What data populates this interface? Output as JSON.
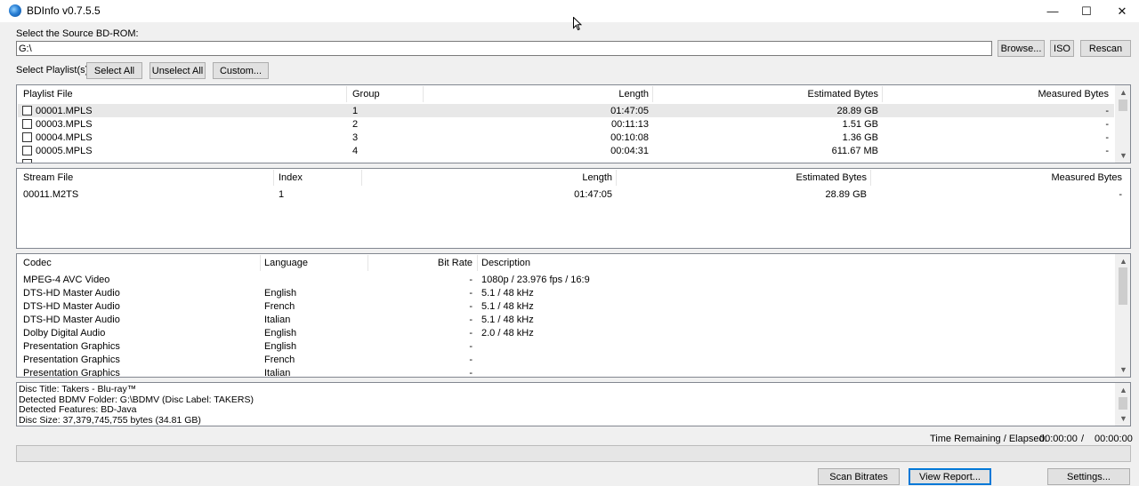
{
  "window": {
    "title": "BDInfo v0.7.5.5",
    "controls": {
      "minimize": "—",
      "maximize": "☐",
      "close": "✕"
    }
  },
  "source": {
    "label": "Select the Source BD-ROM:",
    "path": "G:\\",
    "browse": "Browse...",
    "iso": "ISO",
    "rescan": "Rescan"
  },
  "playlist_controls": {
    "label": "Select Playlist(s):",
    "select_all": "Select All",
    "unselect_all": "Unselect All",
    "custom": "Custom..."
  },
  "playlists": {
    "columns": [
      "Playlist File",
      "Group",
      "Length",
      "Estimated Bytes",
      "Measured Bytes"
    ],
    "rows": [
      {
        "file": "00001.MPLS",
        "group": "1",
        "length": "01:47:05",
        "estimated": "28.89 GB",
        "measured": "-"
      },
      {
        "file": "00003.MPLS",
        "group": "2",
        "length": "00:11:13",
        "estimated": "1.51 GB",
        "measured": "-"
      },
      {
        "file": "00004.MPLS",
        "group": "3",
        "length": "00:10:08",
        "estimated": "1.36 GB",
        "measured": "-"
      },
      {
        "file": "00005.MPLS",
        "group": "4",
        "length": "00:04:31",
        "estimated": "611.67 MB",
        "measured": "-"
      }
    ]
  },
  "streams": {
    "columns": [
      "Stream File",
      "Index",
      "Length",
      "Estimated Bytes",
      "Measured Bytes"
    ],
    "rows": [
      {
        "file": "00011.M2TS",
        "index": "1",
        "length": "01:47:05",
        "estimated": "28.89 GB",
        "measured": "-"
      }
    ]
  },
  "codecs": {
    "columns": [
      "Codec",
      "Language",
      "Bit Rate",
      "Description"
    ],
    "rows": [
      {
        "codec": "MPEG-4 AVC Video",
        "language": "",
        "bitrate": "-",
        "description": "1080p / 23.976 fps / 16:9"
      },
      {
        "codec": "DTS-HD Master Audio",
        "language": "English",
        "bitrate": "-",
        "description": "5.1 / 48 kHz"
      },
      {
        "codec": "DTS-HD Master Audio",
        "language": "French",
        "bitrate": "-",
        "description": "5.1 / 48 kHz"
      },
      {
        "codec": "DTS-HD Master Audio",
        "language": "Italian",
        "bitrate": "-",
        "description": "5.1 / 48 kHz"
      },
      {
        "codec": "Dolby Digital Audio",
        "language": "English",
        "bitrate": "-",
        "description": "2.0 / 48 kHz"
      },
      {
        "codec": "Presentation Graphics",
        "language": "English",
        "bitrate": "-",
        "description": ""
      },
      {
        "codec": "Presentation Graphics",
        "language": "French",
        "bitrate": "-",
        "description": ""
      },
      {
        "codec": "Presentation Graphics",
        "language": "Italian",
        "bitrate": "-",
        "description": ""
      }
    ]
  },
  "disc_info": {
    "lines": [
      "Disc Title: Takers - Blu-ray™",
      "Detected BDMV Folder: G:\\BDMV (Disc Label: TAKERS)",
      "Detected Features: BD-Java",
      "Disc Size: 37,379,745,755 bytes (34.81 GB)"
    ]
  },
  "status": {
    "time_label": "Time Remaining / Elapsed:",
    "remaining": "00:00:00",
    "separator": "/",
    "elapsed": "00:00:00",
    "progress": 0
  },
  "footer": {
    "scan_bitrates": "Scan Bitrates",
    "view_report": "View Report...",
    "settings": "Settings..."
  },
  "icons": {
    "app": "bdinfo-disc-icon",
    "scroll_up": "▲",
    "scroll_down": "▼"
  }
}
